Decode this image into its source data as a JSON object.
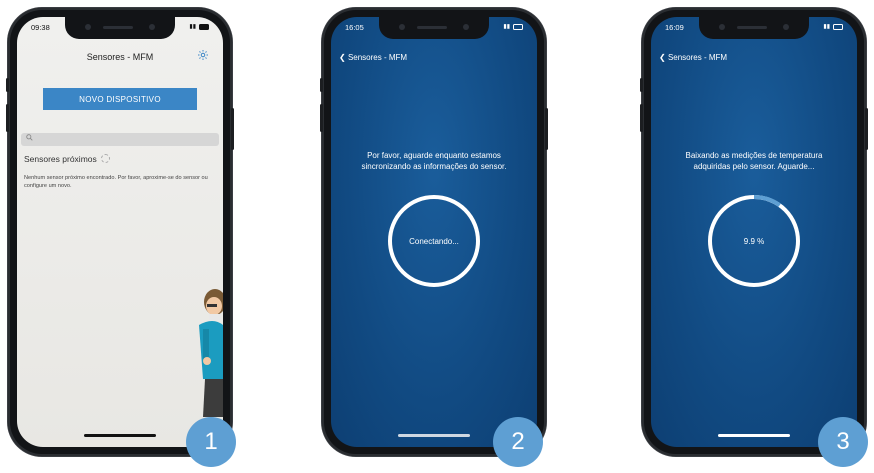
{
  "colors": {
    "accent": "#3b86c6",
    "blue_bg": "#114a82",
    "badge": "#5e9fd3"
  },
  "phone1": {
    "time": "09:38",
    "title": "Sensores - MFM",
    "settings_icon": "gear-icon",
    "primary_button": "NOVO DISPOSITIVO",
    "search_icon": "search-icon",
    "section_title": "Sensores próximos",
    "empty_message": "Nenhum sensor próximo encontrado. Por favor, aproxime-se do sensor ou configure um novo.",
    "badge": "1"
  },
  "phone2": {
    "time": "16:05",
    "back_label": "Sensores - MFM",
    "message": "Por favor, aguarde enquanto estamos sincronizando as informações do sensor.",
    "status": "Conectando...",
    "badge": "2"
  },
  "phone3": {
    "time": "16:09",
    "back_label": "Sensores - MFM",
    "message": "Baixando as medições de temperatura adquiridas pelo sensor. Aguarde...",
    "progress_label": "9.9 %",
    "progress_fraction": 0.099,
    "badge": "3"
  }
}
